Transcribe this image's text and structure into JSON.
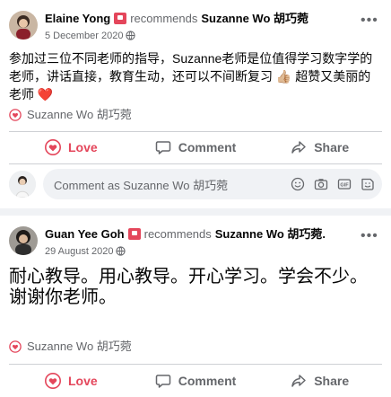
{
  "posts": [
    {
      "author": "Elaine Yong",
      "recommends_word": "recommends",
      "target": "Suzanne Wo 胡巧菀",
      "date": "5 December 2020",
      "body": "参加过三位不同老师的指导，Suzanne老师是位值得学习数字学的老师，讲话直接，教育生动，还可以不间断复习 👍🏼 超赞又美丽的老师 ❤️",
      "rec_label": "Suzanne Wo 胡巧菀",
      "actions": {
        "love": "Love",
        "comment": "Comment",
        "share": "Share"
      },
      "comment_placeholder": "Comment as Suzanne Wo 胡巧菀"
    },
    {
      "author": "Guan Yee Goh",
      "recommends_word": "recommends",
      "target": "Suzanne Wo 胡巧菀.",
      "date": "29 August 2020",
      "body_line1": "耐心教导。用心教导。开心学习。学会不少。",
      "body_line2": "谢谢你老师。",
      "rec_label": "Suzanne Wo 胡巧菀",
      "actions": {
        "love": "Love",
        "comment": "Comment",
        "share": "Share"
      }
    }
  ],
  "icons": {
    "recommend_badge": "recommend-badge-icon",
    "globe": "globe-icon",
    "more": "more-options-icon",
    "heart": "heart-icon",
    "comment": "comment-icon",
    "share": "share-icon",
    "emoji": "emoji-icon",
    "camera": "camera-icon",
    "gif": "gif-icon",
    "sticker": "sticker-icon"
  },
  "colors": {
    "love": "#e4465b",
    "muted": "#65676b",
    "background": "#f0f2f5"
  }
}
